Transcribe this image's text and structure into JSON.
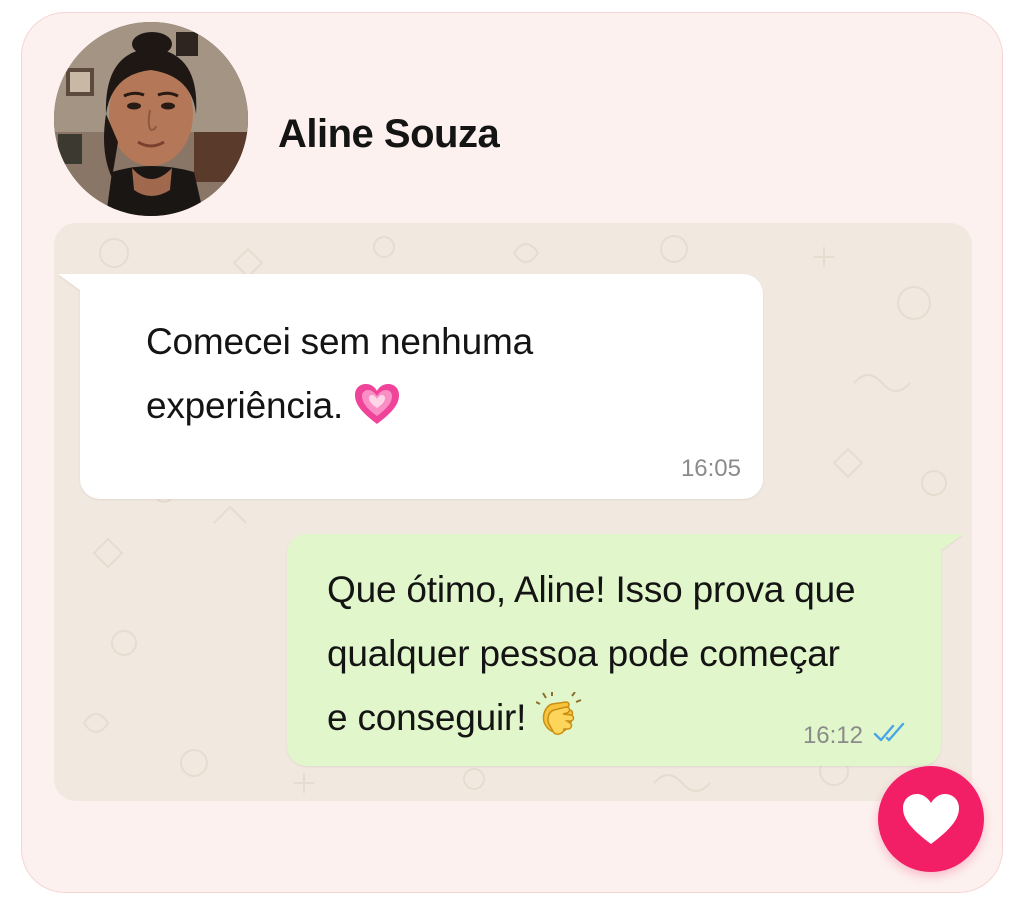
{
  "contact": {
    "name": "Aline Souza"
  },
  "messages": [
    {
      "direction": "incoming",
      "lines": [
        "Comecei sem nenhuma",
        "experiência."
      ],
      "emoji": "pink-heart",
      "time": "16:05"
    },
    {
      "direction": "outgoing",
      "lines": [
        "Que ótimo, Aline! Isso prova que",
        "qualquer pessoa pode começar",
        "e conseguir!"
      ],
      "emoji": "clapping-hands",
      "time": "16:12",
      "status_icon": "double-check-read-icon"
    }
  ],
  "fab": {
    "icon": "heart-icon"
  },
  "colors": {
    "card_background": "#fcf1ee",
    "chat_background": "#f1e9df",
    "incoming_bubble": "#ffffff",
    "outgoing_bubble": "#e1f7cb",
    "read_ticks": "#4aa6e6",
    "heart_button": "#f21f66"
  }
}
